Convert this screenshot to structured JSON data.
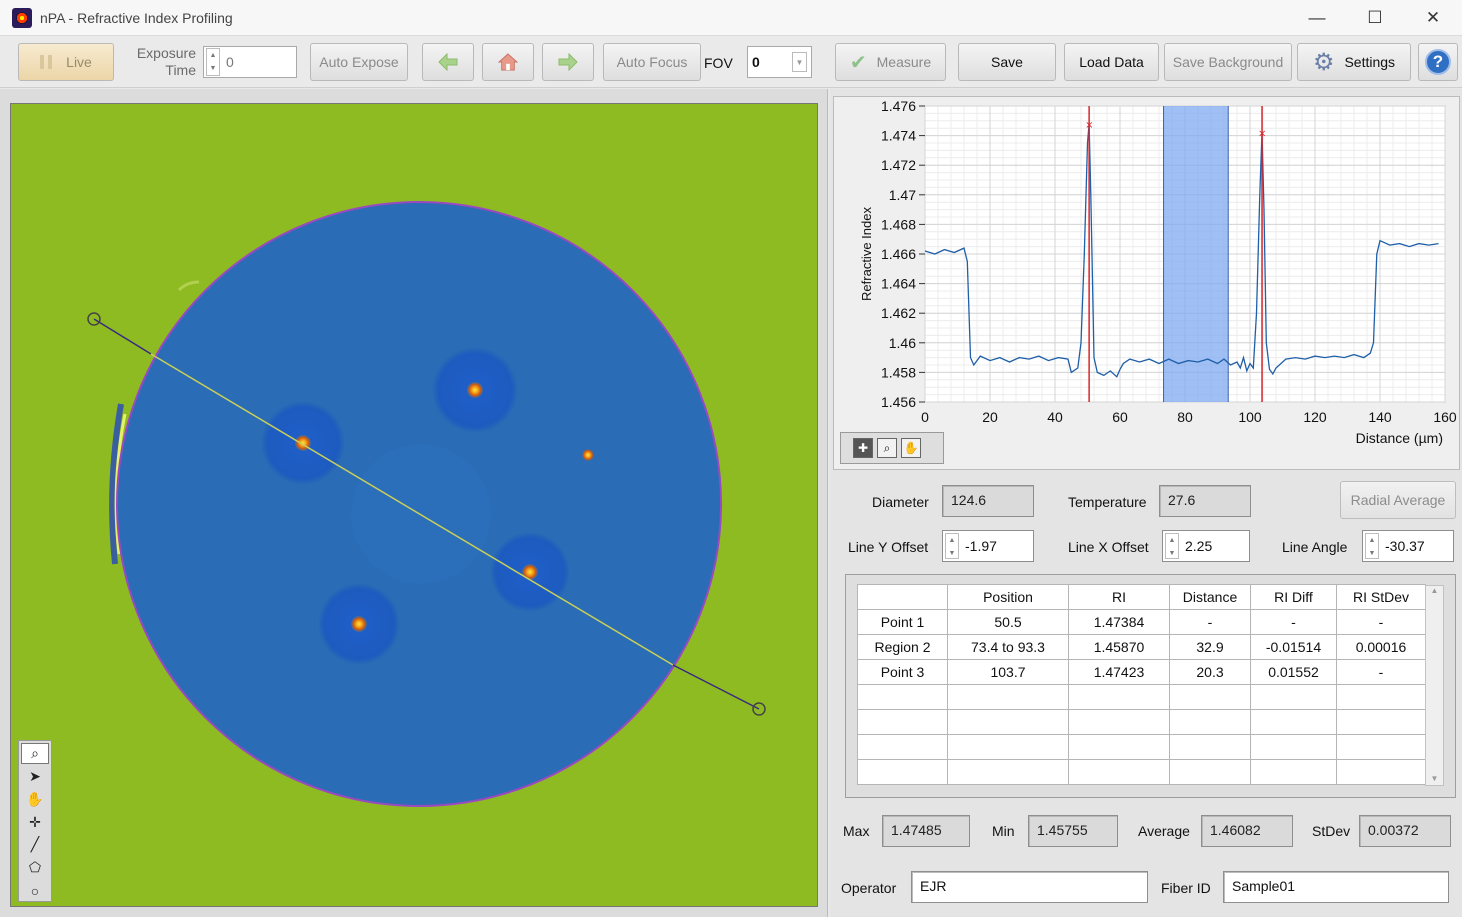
{
  "window": {
    "title": "nPA - Refractive Index Profiling",
    "minimize": "—",
    "maximize": "☐",
    "close": "✕"
  },
  "toolbar": {
    "live_label": "Live",
    "exposure_label_line1": "Exposure",
    "exposure_label_line2": "Time",
    "exposure_value": "0",
    "auto_expose_label": "Auto Expose",
    "auto_focus_label": "Auto Focus",
    "fov_label": "FOV",
    "fov_value": "0",
    "measure_label": "Measure",
    "save_label": "Save",
    "load_data_label": "Load Data",
    "save_background_label": "Save Background",
    "settings_label": "Settings",
    "help_glyph": "?"
  },
  "colors": {
    "background_field": "#8fbb22",
    "fiber_core": "#2a6cb5",
    "line_color": "#b7c34a",
    "plot_line": "#1f5fa8",
    "cursor_red": "#d9262a",
    "region_blue": "#7faaf2"
  },
  "chart_data": {
    "type": "line",
    "xlabel": "Distance (µm)",
    "ylabel": "Refractive Index",
    "xlim": [
      0,
      160
    ],
    "ylim": [
      1.456,
      1.476
    ],
    "x_ticks": [
      "0",
      "20",
      "40",
      "60",
      "80",
      "100",
      "120",
      "140",
      "160"
    ],
    "y_ticks": [
      "1.456",
      "1.458",
      "1.46",
      "1.462",
      "1.464",
      "1.466",
      "1.468",
      "1.47",
      "1.472",
      "1.474",
      "1.476"
    ],
    "grid": true,
    "cursors_x": [
      50.5,
      103.7
    ],
    "region": [
      73.4,
      93.3
    ],
    "profile": [
      [
        0,
        1.4662
      ],
      [
        3,
        1.466
      ],
      [
        6,
        1.4663
      ],
      [
        9,
        1.4661
      ],
      [
        12,
        1.4664
      ],
      [
        13,
        1.4655
      ],
      [
        14,
        1.459
      ],
      [
        15,
        1.4585
      ],
      [
        17,
        1.4591
      ],
      [
        20,
        1.4588
      ],
      [
        23,
        1.459
      ],
      [
        26,
        1.4587
      ],
      [
        29,
        1.459
      ],
      [
        32,
        1.4589
      ],
      [
        35,
        1.4591
      ],
      [
        38,
        1.4588
      ],
      [
        41,
        1.459
      ],
      [
        44,
        1.4589
      ],
      [
        45,
        1.458
      ],
      [
        47,
        1.4583
      ],
      [
        48,
        1.46
      ],
      [
        49,
        1.466
      ],
      [
        50,
        1.4735
      ],
      [
        50.5,
        1.4748
      ],
      [
        51,
        1.47
      ],
      [
        52,
        1.459
      ],
      [
        53,
        1.458
      ],
      [
        55,
        1.4578
      ],
      [
        57,
        1.4581
      ],
      [
        59,
        1.4577
      ],
      [
        60,
        1.4582
      ],
      [
        61,
        1.4586
      ],
      [
        63,
        1.4589
      ],
      [
        66,
        1.4587
      ],
      [
        69,
        1.4589
      ],
      [
        72,
        1.4586
      ],
      [
        75,
        1.4589
      ],
      [
        78,
        1.4586
      ],
      [
        81,
        1.4588
      ],
      [
        84,
        1.4587
      ],
      [
        87,
        1.4589
      ],
      [
        90,
        1.4586
      ],
      [
        92,
        1.4589
      ],
      [
        94,
        1.4585
      ],
      [
        96,
        1.4587
      ],
      [
        97,
        1.4583
      ],
      [
        98,
        1.459
      ],
      [
        99,
        1.4581
      ],
      [
        100,
        1.4586
      ],
      [
        101,
        1.4583
      ],
      [
        102,
        1.462
      ],
      [
        103,
        1.47
      ],
      [
        103.7,
        1.4742
      ],
      [
        104.3,
        1.469
      ],
      [
        105,
        1.46
      ],
      [
        106,
        1.4582
      ],
      [
        107,
        1.4579
      ],
      [
        108,
        1.4583
      ],
      [
        111,
        1.4589
      ],
      [
        114,
        1.459
      ],
      [
        117,
        1.4589
      ],
      [
        120,
        1.4591
      ],
      [
        123,
        1.459
      ],
      [
        126,
        1.4591
      ],
      [
        129,
        1.459
      ],
      [
        132,
        1.4592
      ],
      [
        135,
        1.459
      ],
      [
        137,
        1.4593
      ],
      [
        138,
        1.46
      ],
      [
        139,
        1.466
      ],
      [
        140,
        1.4669
      ],
      [
        143,
        1.4666
      ],
      [
        146,
        1.4667
      ],
      [
        149,
        1.4665
      ],
      [
        152,
        1.4667
      ],
      [
        155,
        1.4666
      ],
      [
        158,
        1.4667
      ]
    ]
  },
  "params": {
    "diameter_label": "Diameter",
    "diameter_value": "124.6",
    "temperature_label": "Temperature",
    "temperature_value": "27.6",
    "radial_average_label": "Radial Average",
    "line_y_offset_label": "Line Y Offset",
    "line_y_offset_value": "-1.97",
    "line_x_offset_label": "Line X Offset",
    "line_x_offset_value": "2.25",
    "line_angle_label": "Line Angle",
    "line_angle_value": "-30.37"
  },
  "table": {
    "headers": [
      "",
      "Position",
      "RI",
      "Distance",
      "RI Diff",
      "RI StDev"
    ],
    "rows": [
      [
        "Point 1",
        "50.5",
        "1.47384",
        "-",
        "-",
        "-"
      ],
      [
        "Region 2",
        "73.4 to 93.3",
        "1.45870",
        "32.9",
        "-0.01514",
        "0.00016"
      ],
      [
        "Point 3",
        "103.7",
        "1.47423",
        "20.3",
        "0.01552",
        "-"
      ],
      [
        "",
        "",
        "",
        "",
        "",
        ""
      ],
      [
        "",
        "",
        "",
        "",
        "",
        ""
      ],
      [
        "",
        "",
        "",
        "",
        "",
        ""
      ],
      [
        "",
        "",
        "",
        "",
        "",
        ""
      ]
    ]
  },
  "stats": {
    "max_label": "Max",
    "max_value": "1.47485",
    "min_label": "Min",
    "min_value": "1.45755",
    "average_label": "Average",
    "average_value": "1.46082",
    "stdev_label": "StDev",
    "stdev_value": "0.00372"
  },
  "meta": {
    "operator_label": "Operator",
    "operator_value": "EJR",
    "fiber_id_label": "Fiber ID",
    "fiber_id_value": "Sample01"
  },
  "image_tools": [
    "zoom-icon",
    "pointer-icon",
    "pan-icon",
    "crosshair-icon",
    "line-tool-icon",
    "polygon-tool-icon",
    "circle-tool-icon"
  ]
}
